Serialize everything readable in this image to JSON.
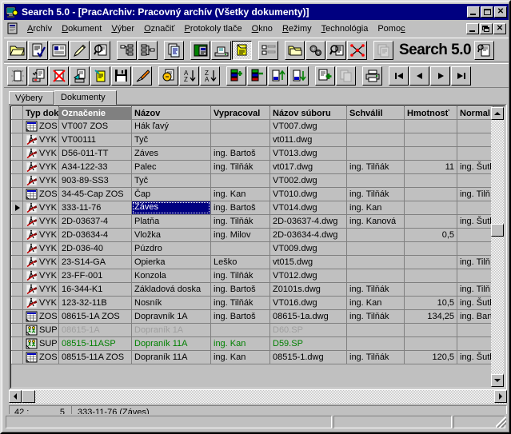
{
  "window": {
    "title": "Search 5.0 - [PracArchiv: Pracovný archív (Všetky dokumenty)]",
    "icon": "app-icon",
    "buttons": {
      "minimize": "_",
      "maximize": "□",
      "close": "✕"
    }
  },
  "mdi": {
    "icon": "document-window-icon",
    "buttons": {
      "minimize": "_",
      "restore": "❐",
      "close": "✕"
    }
  },
  "menu": {
    "items": [
      {
        "label": "Archív",
        "accel": "A"
      },
      {
        "label": "Dokument",
        "accel": "D"
      },
      {
        "label": "Výber",
        "accel": "V"
      },
      {
        "label": "Označiť",
        "accel": "O"
      },
      {
        "label": "Protokoly tlače",
        "accel": "P"
      },
      {
        "label": "Okno",
        "accel": "O"
      },
      {
        "label": "Režimy",
        "accel": "R"
      },
      {
        "label": "Technológia",
        "accel": "T"
      },
      {
        "label": "Pomoc",
        "accel": "c"
      }
    ]
  },
  "toolbar_top": {
    "brand": "Search 5.0",
    "buttons": [
      {
        "name": "open-archive-icon",
        "state": "normal"
      },
      {
        "name": "document-check-icon",
        "state": "normal"
      },
      {
        "name": "document-card-icon",
        "state": "normal"
      },
      {
        "name": "pencil-edit-icon",
        "state": "normal"
      },
      {
        "name": "preview-search-icon",
        "state": "normal"
      },
      {
        "name": "tree-structure-icon",
        "state": "normal"
      },
      {
        "name": "tree-structure-flat-icon",
        "state": "normal"
      },
      {
        "name": "copy-documents-icon",
        "state": "normal"
      },
      {
        "name": "image-view-icon",
        "state": "normal"
      },
      {
        "name": "scanner-icon",
        "state": "normal"
      },
      {
        "name": "selected-document-icon",
        "state": "pressed"
      },
      {
        "name": "list-view-icon",
        "state": "normal"
      },
      {
        "name": "folder-stack-icon",
        "state": "normal"
      },
      {
        "name": "gears-settings-icon",
        "state": "normal"
      },
      {
        "name": "magnify-list-icon",
        "state": "normal"
      },
      {
        "name": "network-graph-icon",
        "state": "normal"
      },
      {
        "name": "documents-disabled-icon",
        "state": "disabled"
      },
      {
        "name": "info-card-icon",
        "state": "normal"
      }
    ]
  },
  "toolbar_second": {
    "buttons": [
      {
        "name": "new-document-icon",
        "state": "normal"
      },
      {
        "name": "document-export-icon",
        "state": "normal"
      },
      {
        "name": "delete-document-icon",
        "state": "normal"
      },
      {
        "name": "import-document-icon",
        "state": "normal"
      },
      {
        "name": "edit-document-icon",
        "state": "normal"
      },
      {
        "name": "save-icon",
        "state": "normal"
      },
      {
        "name": "clear-eraser-icon",
        "state": "normal"
      },
      {
        "name": "refresh-document-icon",
        "state": "normal"
      },
      {
        "name": "sort-ascending-icon",
        "state": "normal"
      },
      {
        "name": "sort-descending-icon",
        "state": "normal"
      },
      {
        "name": "add-row-icon",
        "state": "normal"
      },
      {
        "name": "remove-row-icon",
        "state": "normal"
      },
      {
        "name": "move-up-icon",
        "state": "normal"
      },
      {
        "name": "move-down-icon",
        "state": "normal"
      },
      {
        "name": "add-list-icon",
        "state": "normal"
      },
      {
        "name": "copy-icon",
        "state": "disabled"
      },
      {
        "name": "print-icon",
        "state": "normal"
      },
      {
        "name": "nav-first-icon",
        "state": "normal"
      },
      {
        "name": "nav-prev-icon",
        "state": "normal"
      },
      {
        "name": "nav-next-icon",
        "state": "normal"
      },
      {
        "name": "nav-last-icon",
        "state": "normal"
      }
    ],
    "sort_asc_label": "A\nZ",
    "sort_desc_label": "Z\nA"
  },
  "tabs": [
    {
      "label": "Výbery",
      "active": false
    },
    {
      "label": "Dokumenty",
      "active": true
    }
  ],
  "grid": {
    "columns": [
      {
        "label": "Typ dok",
        "selected": false
      },
      {
        "label": "Označenie",
        "selected": true
      },
      {
        "label": "Názov",
        "selected": false
      },
      {
        "label": "Vypracoval",
        "selected": false
      },
      {
        "label": "Názov súboru",
        "selected": false
      },
      {
        "label": "Schválil",
        "selected": false
      },
      {
        "label": "Hmotnosť",
        "selected": false
      },
      {
        "label": "Normal",
        "selected": false
      }
    ],
    "rows": [
      {
        "marker": false,
        "typ": "ZOS",
        "icon": "zos-icon",
        "oznacenie": "VT007 ZOS",
        "nazov": "Hák ľavý",
        "vypracoval": "",
        "subor": "VT007.dwg",
        "schvalil": "",
        "hmotnost": "",
        "normal": "",
        "highlight": false,
        "style": "normal"
      },
      {
        "marker": false,
        "typ": "VYK",
        "icon": "vyk-icon",
        "oznacenie": "VT00111",
        "nazov": "Tyč",
        "vypracoval": "",
        "subor": "vt011.dwg",
        "schvalil": "",
        "hmotnost": "",
        "normal": "",
        "highlight": true,
        "style": "normal"
      },
      {
        "marker": false,
        "typ": "VYK",
        "icon": "vyk-icon",
        "oznacenie": "D56-011-TT",
        "nazov": "Záves",
        "vypracoval": "ing. Bartoš",
        "subor": "VT013.dwg",
        "schvalil": "",
        "hmotnost": "",
        "normal": "",
        "highlight": false,
        "style": "normal"
      },
      {
        "marker": false,
        "typ": "VYK",
        "icon": "vyk-icon",
        "oznacenie": "A34-122-33",
        "nazov": "Palec",
        "vypracoval": "ing. Tilňák",
        "subor": "vt017.dwg",
        "schvalil": "ing. Tilňák",
        "hmotnost": "11",
        "normal": "ing. Šutk",
        "highlight": false,
        "style": "normal"
      },
      {
        "marker": false,
        "typ": "VYK",
        "icon": "vyk-icon",
        "oznacenie": "903-89-SS3",
        "nazov": "Tyč",
        "vypracoval": "",
        "subor": "VT002.dwg",
        "schvalil": "",
        "hmotnost": "",
        "normal": "",
        "highlight": false,
        "style": "normal"
      },
      {
        "marker": false,
        "typ": "ZOS",
        "icon": "zos-icon",
        "oznacenie": "34-45-Cap ZOS",
        "nazov": "Čap",
        "vypracoval": "ing. Kan",
        "subor": "VT010.dwg",
        "schvalil": "ing. Tilňák",
        "hmotnost": "",
        "normal": "ing. Tilň",
        "highlight": true,
        "style": "normal"
      },
      {
        "marker": true,
        "typ": "VYK",
        "icon": "vyk-icon",
        "oznacenie": "333-11-76",
        "nazov": "Záves",
        "nazov_selected": true,
        "vypracoval": "ing. Bartoš",
        "subor": "VT014.dwg",
        "schvalil": "ing. Kan",
        "hmotnost": "",
        "normal": "",
        "highlight": false,
        "style": "normal"
      },
      {
        "marker": false,
        "typ": "VYK",
        "icon": "vyk-icon",
        "oznacenie": "2D-03637-4",
        "nazov": "Platňa",
        "vypracoval": "ing. Tilňák",
        "subor": "2D-03637-4.dwg",
        "schvalil": "ing. Kanová",
        "hmotnost": "",
        "normal": "ing. Šutk",
        "highlight": false,
        "style": "normal"
      },
      {
        "marker": false,
        "typ": "VYK",
        "icon": "vyk-icon",
        "oznacenie": "2D-03634-4",
        "nazov": "Vložka",
        "vypracoval": "ing. Milov",
        "subor": "2D-03634-4.dwg",
        "schvalil": "",
        "hmotnost": "0,5",
        "normal": "",
        "highlight": true,
        "style": "normal"
      },
      {
        "marker": false,
        "typ": "VYK",
        "icon": "vyk-icon",
        "oznacenie": "2D-036-40",
        "nazov": "Púzdro",
        "vypracoval": "",
        "subor": "VT009.dwg",
        "schvalil": "",
        "hmotnost": "",
        "normal": "",
        "highlight": true,
        "style": "normal"
      },
      {
        "marker": false,
        "typ": "VYK",
        "icon": "vyk-icon",
        "oznacenie": "23-S14-GA",
        "nazov": "Opierka",
        "vypracoval": "Leško",
        "subor": "vt015.dwg",
        "schvalil": "",
        "hmotnost": "",
        "normal": "ing. Tilň",
        "highlight": true,
        "style": "normal"
      },
      {
        "marker": false,
        "typ": "VYK",
        "icon": "vyk-icon",
        "oznacenie": "23-FF-001",
        "nazov": "Konzola",
        "vypracoval": "ing. Tilňák",
        "subor": "VT012.dwg",
        "schvalil": "",
        "hmotnost": "",
        "normal": "",
        "highlight": false,
        "style": "normal"
      },
      {
        "marker": false,
        "typ": "VYK",
        "icon": "vyk-icon",
        "oznacenie": "16-344-K1",
        "nazov": "Základová doska",
        "vypracoval": "ing. Bartoš",
        "subor": "Z0101s.dwg",
        "schvalil": "ing. Tilňák",
        "hmotnost": "",
        "normal": "ing. Tilň",
        "highlight": false,
        "style": "normal"
      },
      {
        "marker": false,
        "typ": "VYK",
        "icon": "vyk-icon",
        "oznacenie": "123-32-11B",
        "nazov": "Nosník",
        "vypracoval": "ing. Tilňák",
        "subor": "VT016.dwg",
        "schvalil": "ing. Kan",
        "hmotnost": "10,5",
        "normal": "ing. Šutk",
        "highlight": false,
        "style": "normal"
      },
      {
        "marker": false,
        "typ": "ZOS",
        "icon": "zos-icon",
        "oznacenie": "08615-1A ZOS",
        "nazov": "Dopravník 1A",
        "vypracoval": "ing. Bartoš",
        "subor": "08615-1a.dwg",
        "schvalil": "ing. Tilňák",
        "hmotnost": "134,25",
        "normal": "ing. Bart",
        "highlight": false,
        "style": "normal"
      },
      {
        "marker": false,
        "typ": "SUP",
        "icon": "sup-icon",
        "oznacenie": "08615-1A",
        "nazov": "Dopraník 1A",
        "vypracoval": "",
        "subor": "D60.SP",
        "schvalil": "",
        "hmotnost": "",
        "normal": "",
        "highlight": false,
        "style": "dim"
      },
      {
        "marker": false,
        "typ": "SUP",
        "icon": "sup-icon",
        "oznacenie": "08515-11ASP",
        "nazov": "Dopraník 11A",
        "vypracoval": "ing. Kan",
        "subor": "D59.SP",
        "schvalil": "",
        "hmotnost": "",
        "normal": "",
        "highlight": false,
        "style": "green"
      },
      {
        "marker": false,
        "typ": "ZOS",
        "icon": "zos-icon",
        "oznacenie": "08515-11A ZOS",
        "nazov": "Dopraník 11A",
        "vypracoval": "ing. Kan",
        "subor": "08515-1.dwg",
        "schvalil": "ing. Tilňák",
        "hmotnost": "120,5",
        "normal": "ing. Šutk",
        "highlight": false,
        "style": "normal"
      }
    ]
  },
  "doc_status": {
    "record_current": "42 :",
    "record_count": "5",
    "detail": "333-11-76 (Záves)"
  },
  "app_status": {
    "panel1": "",
    "panel2": "",
    "panel3": ""
  },
  "colors": {
    "titlebar": "#000080",
    "face": "#c0c0c0",
    "highlight_row": "#00ffff",
    "selection": "#000080",
    "dim_text": "#a0a0a0",
    "green_text": "#008000"
  }
}
